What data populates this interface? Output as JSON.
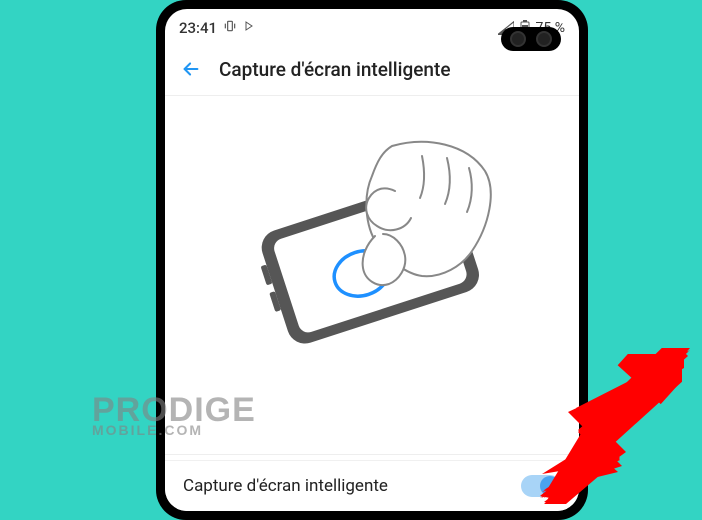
{
  "status": {
    "time": "23:41",
    "battery_text": "75 %"
  },
  "header": {
    "title": "Capture d'écran intelligente"
  },
  "setting": {
    "label": "Capture d'écran intelligente",
    "enabled": true
  },
  "watermark": {
    "line1": "PRODIGE",
    "line2": "MOBILE.COM"
  },
  "colors": {
    "accent": "#4aa3f0",
    "background": "#33d4c3",
    "arrow": "#ff0000"
  }
}
